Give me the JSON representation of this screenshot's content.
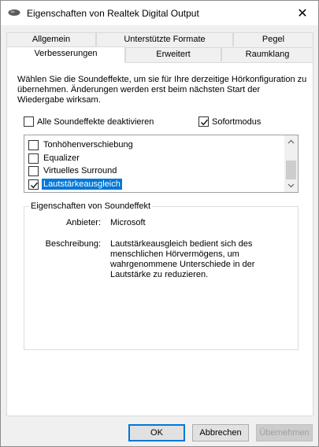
{
  "window": {
    "title": "Eigenschaften von Realtek Digital Output",
    "icon": "speaker-icon",
    "close_glyph": "✕"
  },
  "tabs": {
    "row1": [
      {
        "label": "Allgemein"
      },
      {
        "label": "Unterstützte Formate"
      },
      {
        "label": "Pegel"
      }
    ],
    "row2": [
      {
        "label": "Verbesserungen",
        "active": true
      },
      {
        "label": "Erweitert"
      },
      {
        "label": "Raumklang"
      }
    ]
  },
  "panel": {
    "description": "Wählen Sie die Soundeffekte, um sie für Ihre derzeitige Hörkonfiguration zu übernehmen. Änderungen werden erst beim nächsten Start der Wiedergabe wirksam.",
    "disable_all": {
      "label": "Alle Soundeffekte deaktivieren",
      "checked": false
    },
    "immediate_mode": {
      "label": "Sofortmodus",
      "checked": true
    },
    "effects": [
      {
        "label": "Tonhöhenverschiebung",
        "checked": false,
        "selected": false
      },
      {
        "label": "Equalizer",
        "checked": false,
        "selected": false
      },
      {
        "label": "Virtuelles Surround",
        "checked": false,
        "selected": false
      },
      {
        "label": "Lautstärkeausgleich",
        "checked": true,
        "selected": true
      }
    ],
    "properties": {
      "group_title": "Eigenschaften von Soundeffekt",
      "provider_label": "Anbieter:",
      "provider_value": "Microsoft",
      "description_label": "Beschreibung:",
      "description_lines": [
        "Lautstärkeausgleich bedient sich des",
        "menschlichen Hörvermögens, um",
        "wahrgenommene Unterschiede in der",
        "Lautstärke zu reduzieren."
      ]
    }
  },
  "buttons": {
    "ok": "OK",
    "cancel": "Abbrechen",
    "apply": "Übernehmen"
  },
  "colors": {
    "selection": "#0078d7",
    "dialog_bg": "#f0f0f0"
  }
}
